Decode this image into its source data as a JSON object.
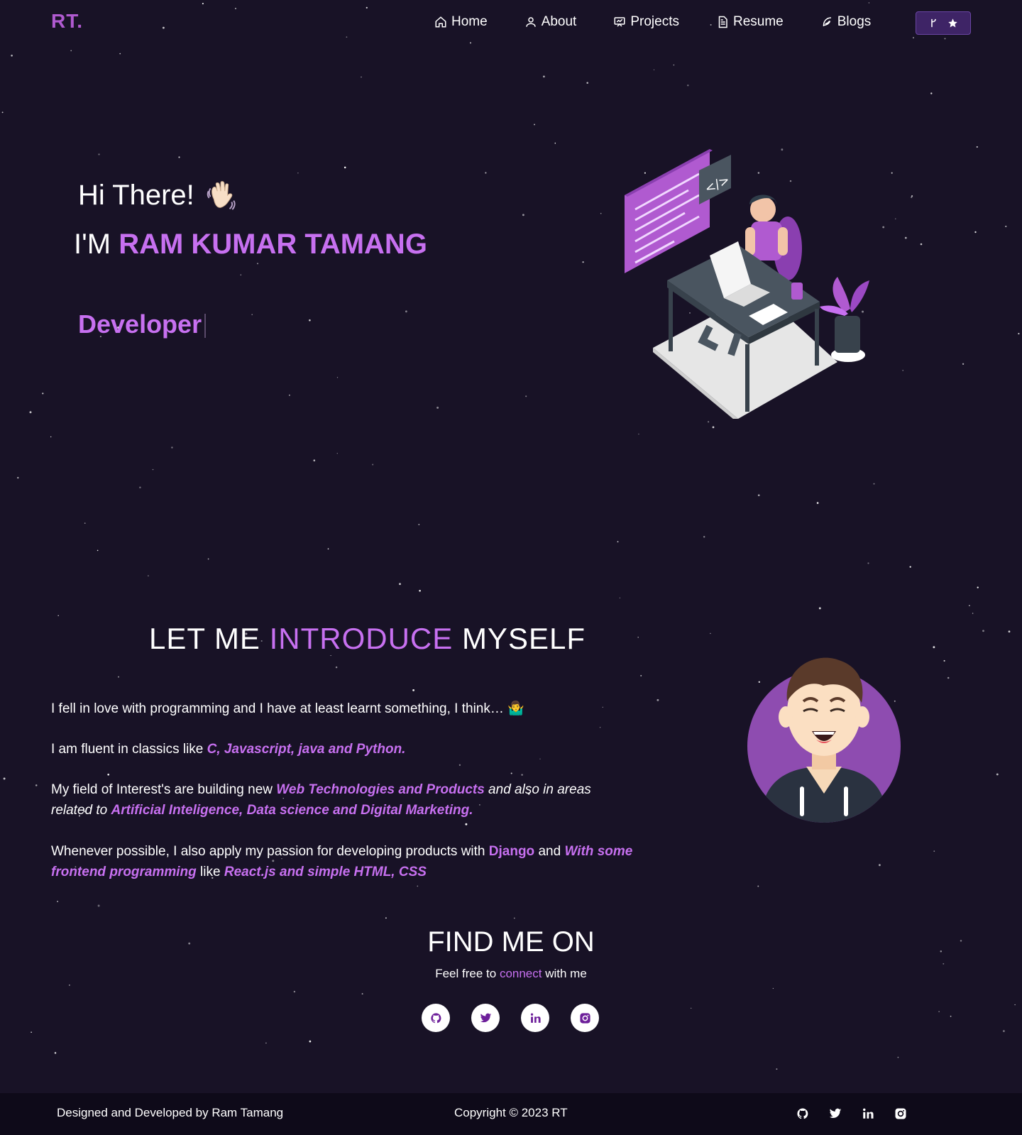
{
  "nav": {
    "logo": "RT.",
    "items": [
      {
        "label": "Home",
        "icon": "home-icon"
      },
      {
        "label": "About",
        "icon": "user-icon"
      },
      {
        "label": "Projects",
        "icon": "projects-icon"
      },
      {
        "label": "Resume",
        "icon": "document-icon"
      },
      {
        "label": "Blogs",
        "icon": "feather-icon"
      }
    ],
    "fork_button": {
      "icons": [
        "git-branch-icon",
        "star-icon"
      ]
    }
  },
  "hero": {
    "greeting": "Hi There!",
    "name_prefix": "I'M ",
    "name": "RAM KUMAR TAMANG",
    "role": "Developer"
  },
  "intro": {
    "title_a": "LET ME ",
    "title_b": "INTRODUCE",
    "title_c": " MYSELF",
    "p1": "I fell in love with programming and I have at least learnt something, I think… 🤷‍♂️",
    "p2_a": "I am fluent in classics like ",
    "p2_b": "C, Javascript, java and Python.",
    "p3_a": "My field of Interest's are building new ",
    "p3_b": "Web Technologies and Products",
    "p3_c": " and also in areas related to ",
    "p3_d": "Artificial Inteligence, Data science and Digital Marketing.",
    "p4_a": "Whenever possible, I also apply my passion for developing products with ",
    "p4_b": "Django",
    "p4_c": " and ",
    "p4_d": "With some frontend programming",
    "p4_e": "  like ",
    "p4_f": "React.js and simple HTML, CSS"
  },
  "find": {
    "title": "FIND ME ON",
    "sub_a": "Feel free to ",
    "sub_b": "connect",
    "sub_c": " with me",
    "socials": [
      "github-icon",
      "twitter-icon",
      "linkedin-icon",
      "instagram-icon"
    ]
  },
  "footer": {
    "left": "Designed and Developed by Ram Tamang",
    "copyright": "Copyright © 2023 RT"
  },
  "colors": {
    "background": "#181226",
    "accent": "#c770f0",
    "footer": "#0e0a19"
  }
}
